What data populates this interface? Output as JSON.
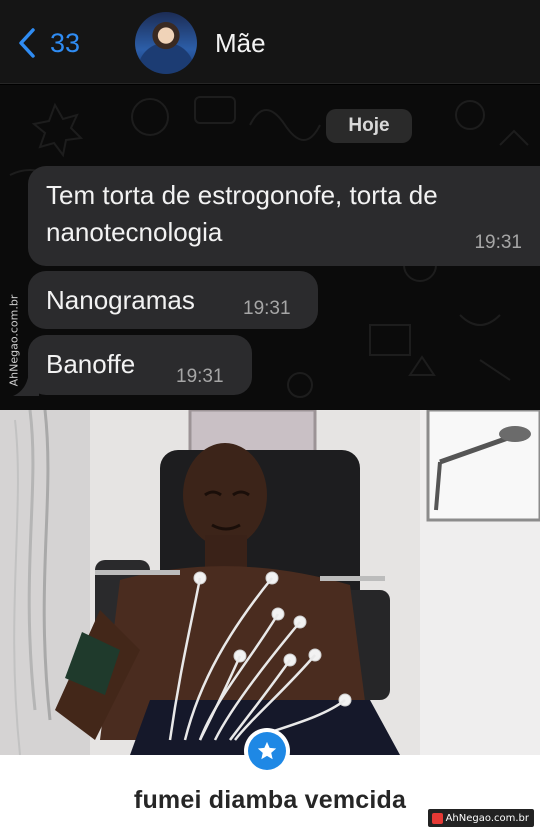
{
  "header": {
    "back_count": "33",
    "contact_name": "Mãe",
    "back_color": "#2f8cf3"
  },
  "chat": {
    "date_label": "Hoje",
    "messages": [
      {
        "text": "Tem torta de estrogonofe, torta de nanotecnologia",
        "time": "19:31"
      },
      {
        "text": "Nanogramas",
        "time": "19:31"
      },
      {
        "text": "Banoffe",
        "time": "19:31"
      }
    ],
    "bubble_color": "#2b2b2d"
  },
  "watermark": {
    "side_text": "AhNegao.com.br",
    "corner_text": "AhNegao.com.br"
  },
  "meme": {
    "caption": "fumei diamba vemcida",
    "badge_icon": "star-icon",
    "badge_color": "#1e88e5"
  }
}
